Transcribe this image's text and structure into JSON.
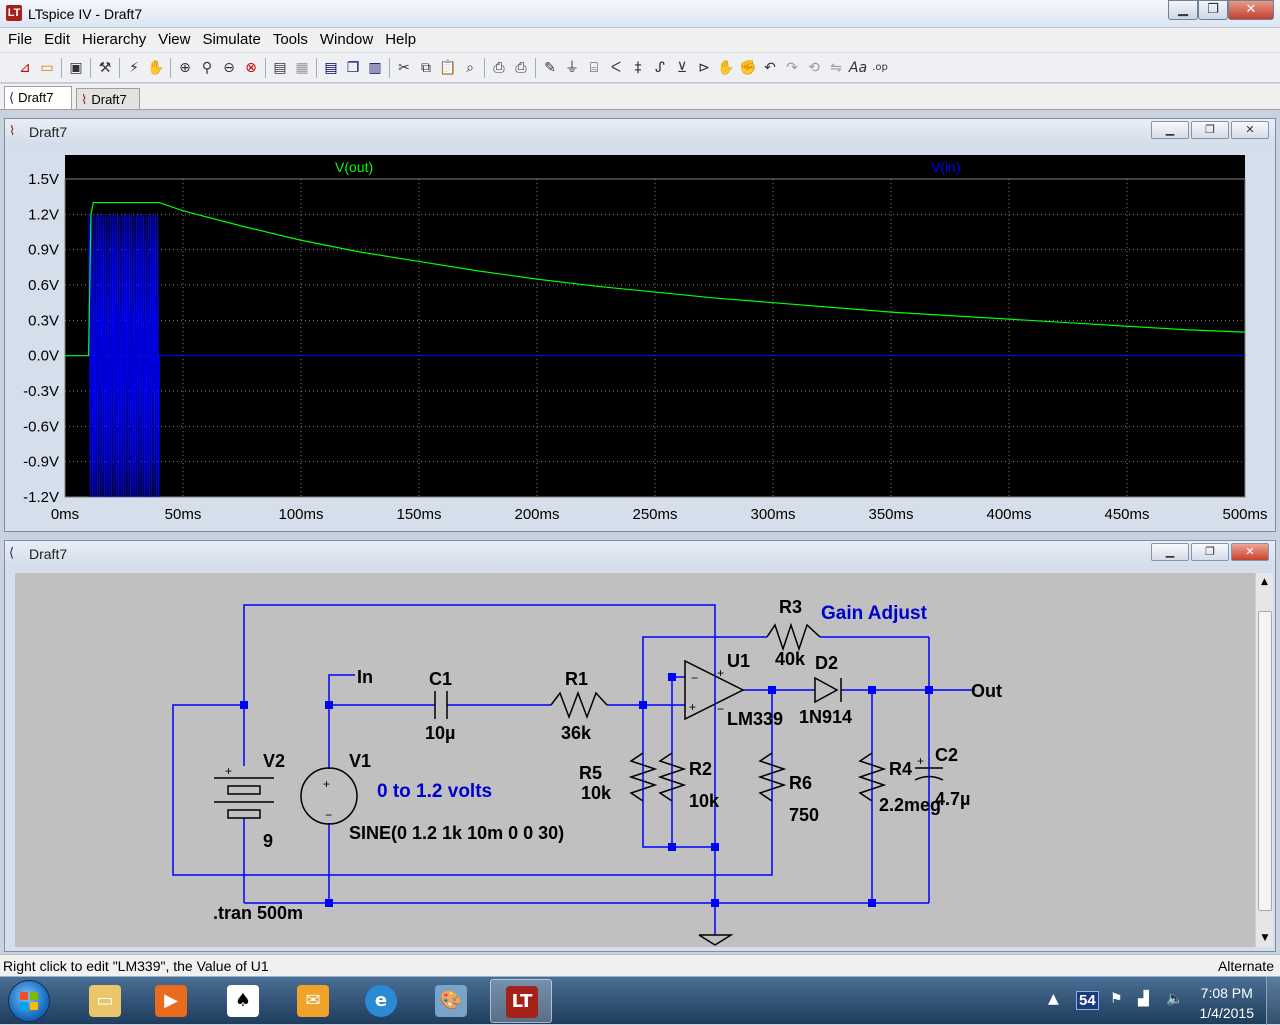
{
  "window": {
    "title": "LTspice IV - Draft7",
    "min_icon": "minimize-icon",
    "max_icon": "restore-icon",
    "close_icon": "close-icon"
  },
  "menu": [
    "File",
    "Edit",
    "Hierarchy",
    "View",
    "Simulate",
    "Tools",
    "Window",
    "Help"
  ],
  "toolbar_icons": [
    "new-schematic-icon",
    "open-icon",
    "save-icon",
    "control-panel-icon",
    "run-icon",
    "halt-icon",
    "zoom-in-icon",
    "zoom-area-icon",
    "zoom-out-icon",
    "zoom-cancel-icon",
    "autorange-icon",
    "grid-icon",
    "tile-horizontal-icon",
    "cascade-icon",
    "tile-vertical-icon",
    "cut-icon",
    "copy-icon",
    "paste-icon",
    "find-icon",
    "print-preview-icon",
    "print-icon",
    "wire-icon",
    "ground-icon",
    "label-icon",
    "resistor-icon",
    "capacitor-icon",
    "inductor-icon",
    "diode-icon",
    "component-icon",
    "move-icon",
    "drag-icon",
    "undo-icon",
    "redo-icon",
    "rotate-icon",
    "mirror-icon",
    "text-icon",
    "spice-directive-icon"
  ],
  "tabs": [
    {
      "label": "Draft7",
      "icon": "schematic-icon"
    },
    {
      "label": "Draft7",
      "icon": "waveform-icon"
    }
  ],
  "plot_window": {
    "title": "Draft7",
    "traces": [
      {
        "name": "V(out)",
        "color": "#00ff00"
      },
      {
        "name": "V(in)",
        "color": "#0000ff"
      }
    ]
  },
  "chart_data": {
    "type": "line",
    "title": "",
    "xlabel": "",
    "ylabel": "",
    "xlim": [
      0,
      500
    ],
    "ylim": [
      -1.2,
      1.5
    ],
    "x_ticks": [
      "0ms",
      "50ms",
      "100ms",
      "150ms",
      "200ms",
      "250ms",
      "300ms",
      "350ms",
      "400ms",
      "450ms",
      "500ms"
    ],
    "y_ticks": [
      "1.5V",
      "1.2V",
      "0.9V",
      "0.6V",
      "0.3V",
      "0.0V",
      "-0.3V",
      "-0.6V",
      "-0.9V",
      "-1.2V"
    ],
    "grid": true,
    "series": [
      {
        "name": "V(out)",
        "color": "#00ff00",
        "x": [
          0,
          10,
          11,
          12,
          40,
          50,
          75,
          100,
          125,
          150,
          175,
          200,
          225,
          250,
          275,
          300,
          325,
          350,
          375,
          400,
          425,
          450,
          475,
          500
        ],
        "y": [
          0,
          0,
          1.2,
          1.3,
          1.3,
          1.23,
          1.1,
          0.98,
          0.88,
          0.8,
          0.72,
          0.65,
          0.59,
          0.54,
          0.49,
          0.45,
          0.41,
          0.37,
          0.34,
          0.31,
          0.28,
          0.25,
          0.22,
          0.2
        ]
      },
      {
        "name": "V(in)",
        "color": "#0000ff",
        "description_freq_hz": 1000,
        "amplitude": 1.2,
        "offset": 0,
        "delay_ms": 10,
        "cycles": 30,
        "x": [
          0,
          10,
          40,
          500
        ],
        "y": [
          0,
          0,
          0,
          0
        ]
      }
    ]
  },
  "schematic_window": {
    "title": "Draft7",
    "components": {
      "R3": {
        "ref": "R3",
        "value": "40k"
      },
      "gain_note": "Gain Adjust",
      "U1": {
        "ref": "U1",
        "value": "LM339"
      },
      "D2": {
        "ref": "D2",
        "value": "1N914"
      },
      "C1": {
        "ref": "C1",
        "value": "10µ"
      },
      "R1": {
        "ref": "R1",
        "value": "36k"
      },
      "V2": {
        "ref": "V2",
        "value": "9"
      },
      "V1": {
        "ref": "V1",
        "value": "SINE(0 1.2 1k 10m 0 0 30)"
      },
      "v1_note": "0 to 1.2 volts",
      "R5": {
        "ref": "R5",
        "value": "10k"
      },
      "R2": {
        "ref": "R2",
        "value": "10k"
      },
      "R6": {
        "ref": "R6",
        "value": "750"
      },
      "R4": {
        "ref": "R4",
        "value": "2.2meg"
      },
      "C2": {
        "ref": "C2",
        "value": "4.7µ"
      }
    },
    "net_in": "In",
    "net_out": "Out",
    "directive": ".tran 500m"
  },
  "status": {
    "left": "Right click to edit \"LM339\", the Value of U1",
    "right": "Alternate"
  },
  "taskbar": {
    "apps": [
      "windows-explorer-icon",
      "media-player-icon",
      "solitaire-icon",
      "outlook-icon",
      "internet-explorer-icon",
      "paint-icon",
      "ltspice-icon"
    ],
    "tray_badge": "54",
    "time": "7:08 PM",
    "date": "1/4/2015"
  },
  "colors": {
    "plot_bg": "#000000",
    "grid": "#808080",
    "vout": "#00ff00",
    "vin": "#0000ff",
    "schematic_bg": "#c0c0c0",
    "wire": "#0000ff",
    "junction": "#0000ff",
    "component": "#000000",
    "note_text": "#0000cc"
  }
}
